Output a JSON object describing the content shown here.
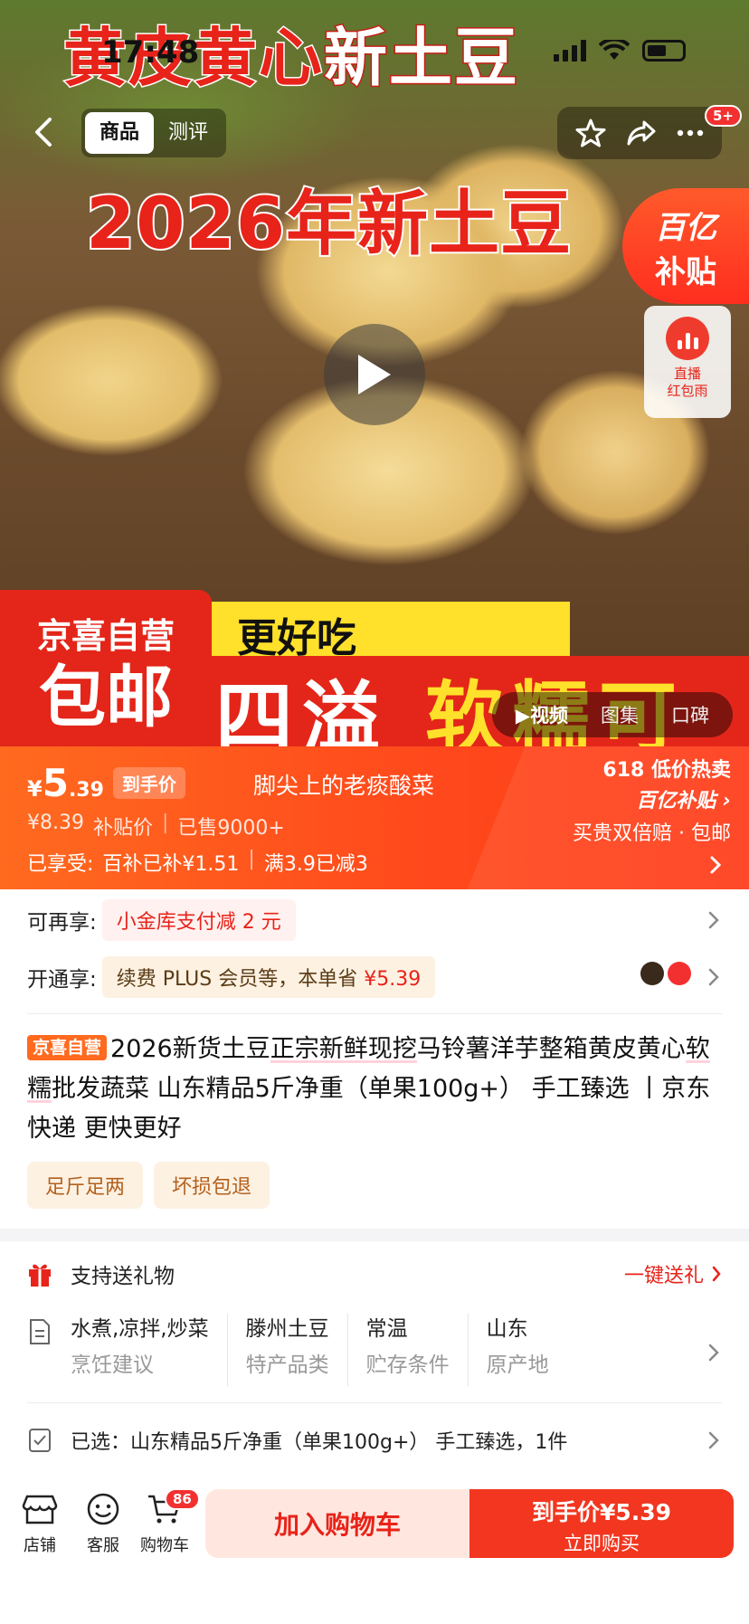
{
  "status": {
    "time": "17:48"
  },
  "hero": {
    "title_top_red": "黄皮黄心",
    "title_top_white": "新土豆",
    "title_mid": "2026年新土豆",
    "promo_yellow": "更好吃",
    "promo_red_left": "四溢",
    "promo_red_right": "软糯可口",
    "jx_top": "京喜自营",
    "jx_bottom": "包邮",
    "subsidy_l1": "百亿",
    "subsidy_l2": "补贴",
    "live_l1": "直播",
    "live_l2": "红包雨"
  },
  "nav": {
    "tabs": [
      {
        "label": "商品"
      },
      {
        "label": "测评"
      }
    ],
    "badge": "5+"
  },
  "media_tabs": [
    {
      "label": "▶视频"
    },
    {
      "label": "图集"
    },
    {
      "label": "口碑"
    }
  ],
  "price": {
    "currency": "¥",
    "int": "5",
    "dec": ".39",
    "tag": "到手价",
    "slogan": "脚尖上的老痰酸菜",
    "original": "¥8.39",
    "original_label": "补贴价",
    "sold": "已售9000+",
    "enjoyed_label": "已享受:",
    "subsidy_applied": "百补已补¥1.51",
    "discount": "满3.9已减3",
    "right_l1": "618 低价热卖",
    "right_l2": "百亿补贴 ›",
    "right_l3": "买贵双倍赔 · 包邮"
  },
  "offers": {
    "extra_label": "可再享:",
    "extra_value": "小金库支付减 2 元",
    "plus_label": "开通享:",
    "plus_value": "续费 PLUS 会员等，本单省 ",
    "plus_amount": "¥5.39"
  },
  "product": {
    "tag": "京喜自营",
    "title_a": "2026新货土豆",
    "title_b": "正宗新鲜现挖",
    "title_c": "马铃薯洋芋整箱黄皮黄心",
    "title_d": "软糯",
    "title_e": "批发蔬菜 山东精品5斤净重（单果100g+） 手工臻选 丨京东快递 更快更好",
    "tags": [
      {
        "label": "足斤足两"
      },
      {
        "label": "坏损包退"
      }
    ]
  },
  "gift": {
    "label": "支持送礼物",
    "action": "一键送礼"
  },
  "specs": [
    {
      "value": "水煮,凉拌,炒菜",
      "key": "烹饪建议"
    },
    {
      "value": "滕州土豆",
      "key": "特产品类"
    },
    {
      "value": "常温",
      "key": "贮存条件"
    },
    {
      "value": "山东",
      "key": "原产地"
    }
  ],
  "selected": {
    "label": "已选：山东精品5斤净重（单果100g+） 手工臻选，1件"
  },
  "bottom": {
    "store": "店铺",
    "service": "客服",
    "cart": "购物车",
    "cart_count": "86",
    "add_cart": "加入购物车",
    "buy_l1": "到手价¥5.39",
    "buy_l2": "立即购买"
  },
  "colors": {
    "accent": "#e8231a",
    "orange": "#ff5a1f"
  }
}
